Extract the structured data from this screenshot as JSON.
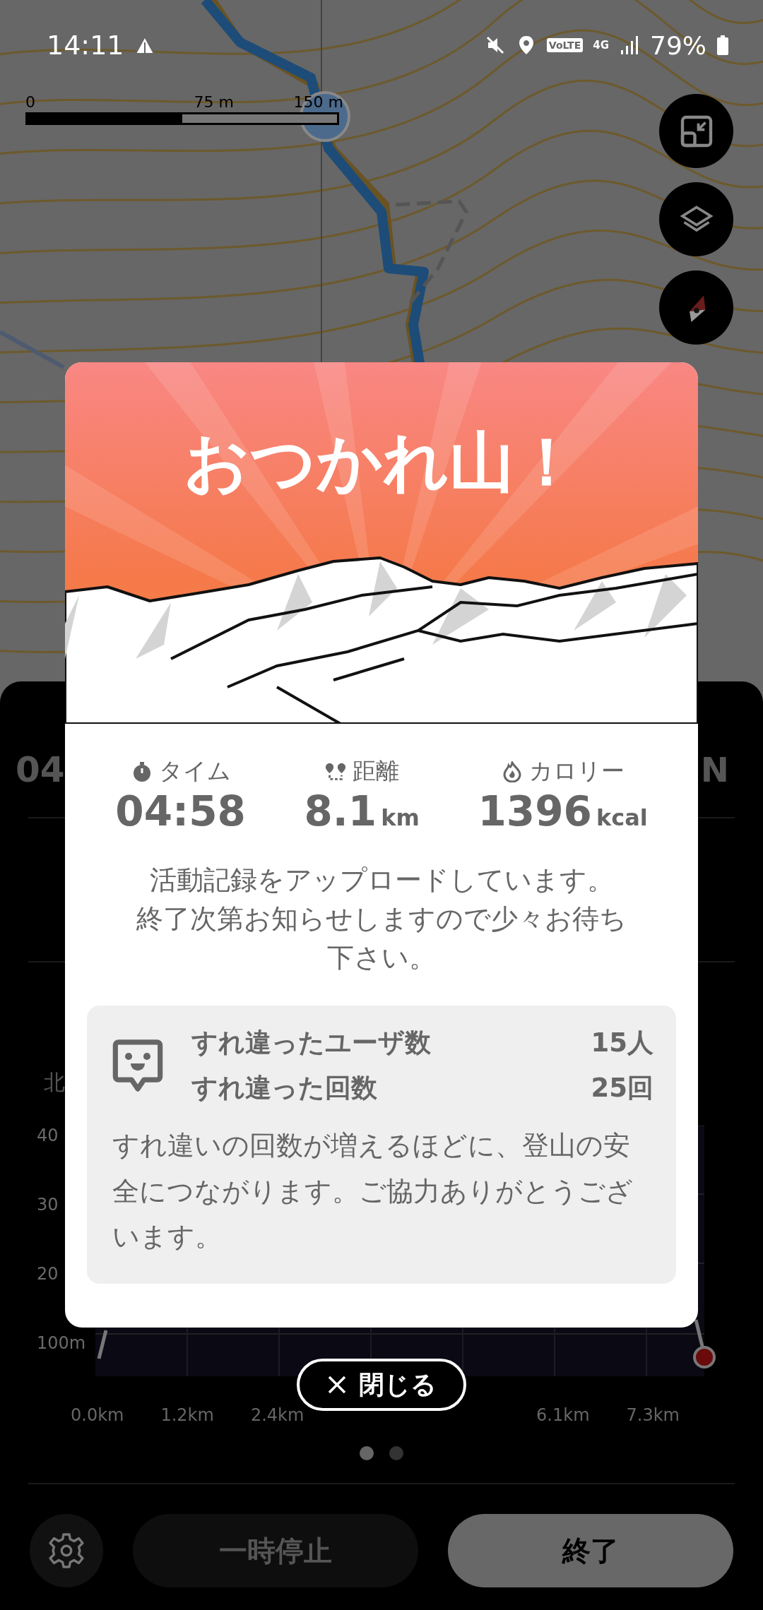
{
  "status_bar": {
    "time": "14:11",
    "volte": "VoLTE",
    "network": "4G",
    "battery": "79%"
  },
  "map": {
    "scale_labels": [
      "0",
      "75 m",
      "150 m"
    ]
  },
  "background_sheet": {
    "time_partial": "04",
    "compass_letter": "N",
    "chart_label_partial": "北",
    "y_labels": [
      "40",
      "30",
      "20",
      "100m"
    ],
    "x_labels_left": [
      "0.0km",
      "1.2km",
      "2.4km"
    ],
    "x_labels_right": [
      "6.1km",
      "7.3km"
    ],
    "pages": [
      {
        "selected": true
      },
      {
        "selected": false
      }
    ],
    "pause_button": "一時停止",
    "end_button": "終了"
  },
  "dialog": {
    "title": "おつかれ山！",
    "stats": [
      {
        "kind": "time",
        "label": "タイム",
        "value": "04:58"
      },
      {
        "kind": "distance",
        "label": "距離",
        "value": "8.1",
        "unit": "km"
      },
      {
        "kind": "calories",
        "label": "カロリー",
        "value": "1396",
        "unit": "kcal"
      }
    ],
    "message_lines": [
      "活動記録をアップロードしています。",
      "終了次第お知らせしますので少々お待ち下さい。"
    ],
    "encounters": {
      "rows": [
        {
          "label": "すれ違ったユーザ数",
          "value": "15人"
        },
        {
          "label": "すれ違った回数",
          "value": "25回"
        }
      ],
      "note": "すれ違いの回数が増えるほどに、登山の安全につながります。ご協力ありがとうございます。"
    },
    "close_button": "閉じる"
  }
}
